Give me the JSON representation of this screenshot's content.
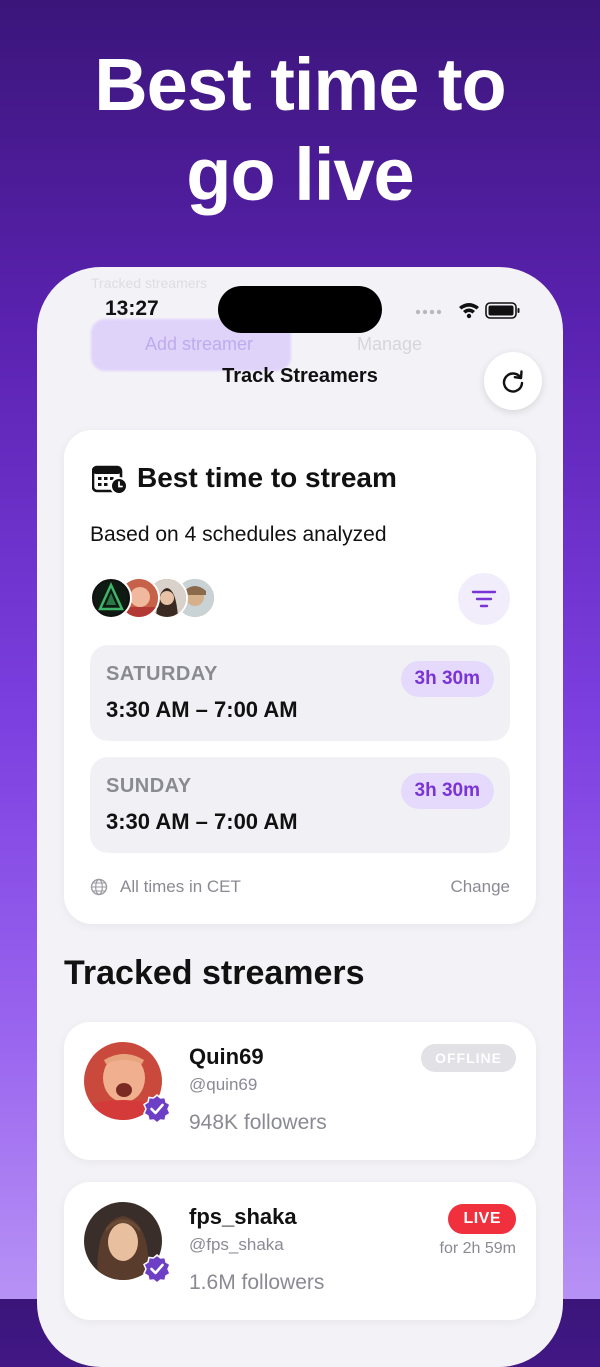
{
  "headline": {
    "line1": "Best time to",
    "line2": "go live"
  },
  "status_bar": {
    "time": "13:27"
  },
  "nav": {
    "title": "Track Streamers"
  },
  "background_ui": {
    "add_label": "Add streamer",
    "manage_label": "Manage",
    "top_label": "Tracked streamers"
  },
  "best_time_card": {
    "title": "Best time to stream",
    "subtitle": "Based on 4 schedules analyzed",
    "slots": [
      {
        "day": "SATURDAY",
        "time": "3:30 AM – 7:00 AM",
        "duration": "3h 30m"
      },
      {
        "day": "SUNDAY",
        "time": "3:30 AM – 7:00 AM",
        "duration": "3h 30m"
      }
    ],
    "timezone_label": "All times in CET",
    "change_label": "Change"
  },
  "tracked": {
    "title": "Tracked streamers",
    "streamers": [
      {
        "name": "Quin69",
        "handle": "@quin69",
        "followers": "948K followers",
        "status": "OFFLINE"
      },
      {
        "name": "fps_shaka",
        "handle": "@fps_shaka",
        "followers": "1.6M followers",
        "status": "LIVE",
        "live_for": "for 2h 59m"
      }
    ]
  },
  "colors": {
    "accent": "#7a34d6",
    "live": "#f0303d",
    "offline": "#e1e1e6",
    "gradient_top": "#3b157a",
    "gradient_bottom": "#b792f5"
  },
  "icons": [
    "calendar-clock-icon",
    "refresh-icon",
    "filter-icon",
    "globe-icon",
    "verified-check-icon",
    "wifi-icon",
    "battery-icon",
    "signal-icon"
  ]
}
